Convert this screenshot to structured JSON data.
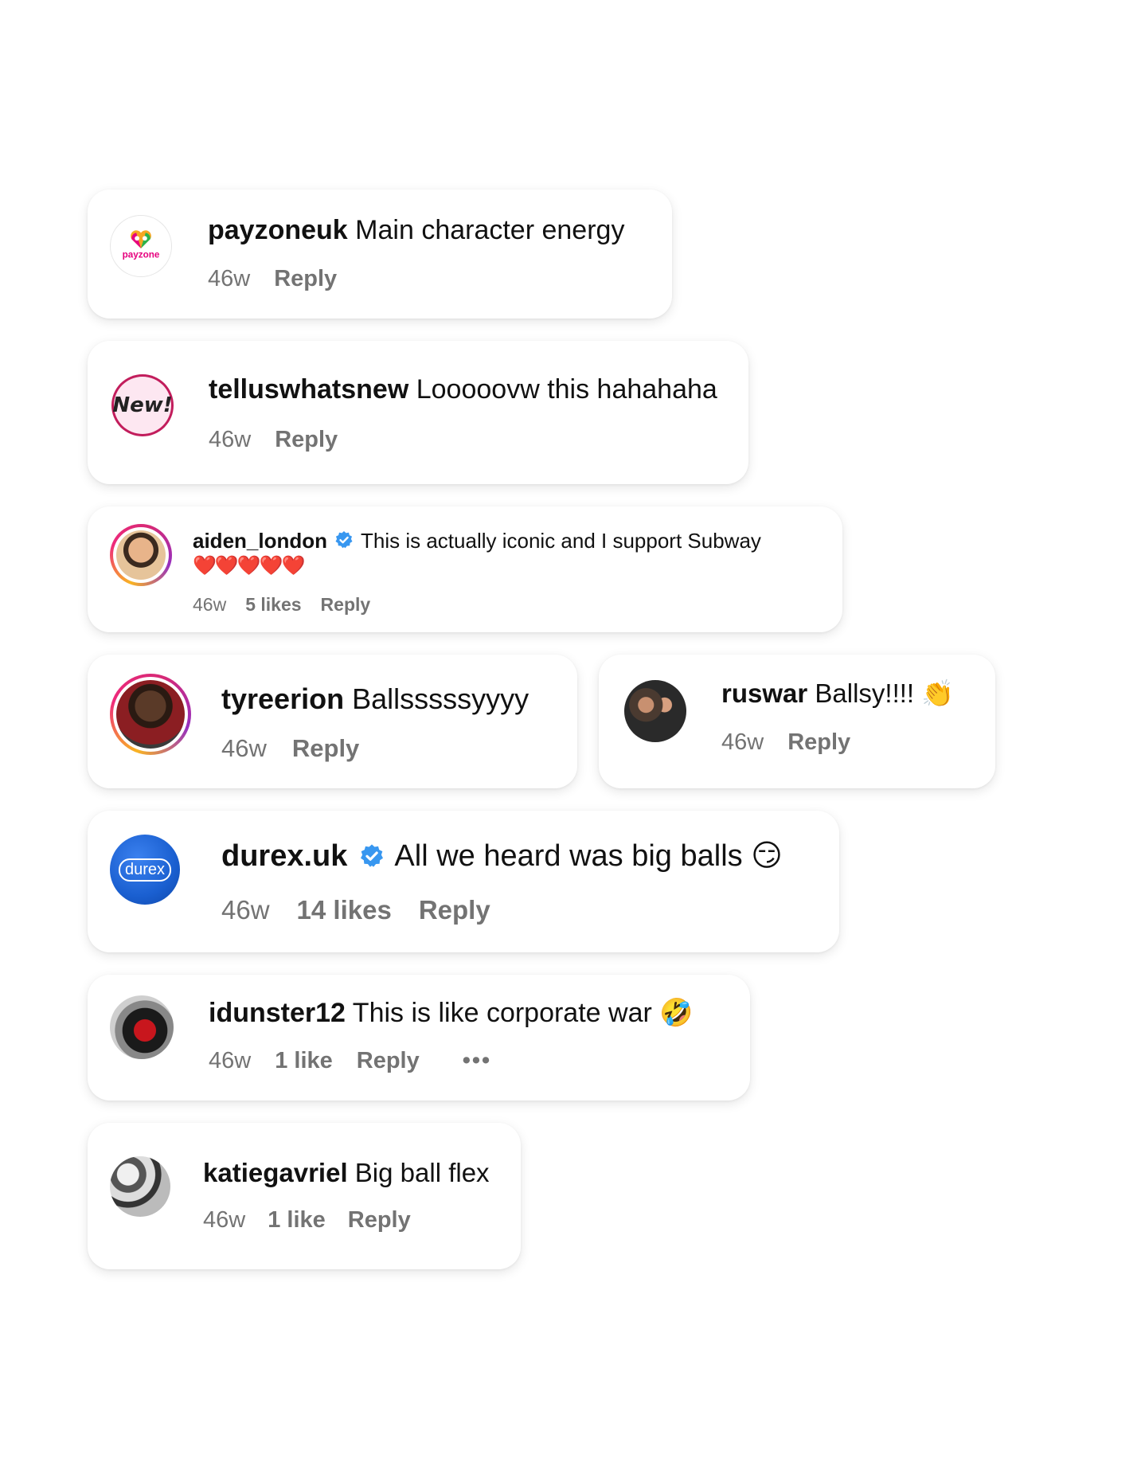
{
  "comments": [
    {
      "username": "payzoneuk",
      "text": "Main character energy",
      "time": "46w",
      "reply": "Reply",
      "avatar_label": "payzone"
    },
    {
      "username": "telluswhatsnew",
      "text": "Looooovw this hahahaha",
      "time": "46w",
      "reply": "Reply",
      "avatar_label": "New!"
    },
    {
      "username": "aiden_london",
      "verified": true,
      "text": "This is actually iconic and I support Subway",
      "text2": "❤️❤️❤️❤️❤️",
      "time": "46w",
      "likes": "5 likes",
      "reply": "Reply"
    },
    {
      "username": "tyreerion",
      "text": "Ballsssssyyyy",
      "time": "46w",
      "reply": "Reply"
    },
    {
      "username": "ruswar",
      "text": "Ballsy!!!! 👏",
      "time": "46w",
      "reply": "Reply"
    },
    {
      "username": "durex.uk",
      "verified": true,
      "text": "All we heard was big balls 😏",
      "time": "46w",
      "likes": "14 likes",
      "reply": "Reply",
      "avatar_label": "durex"
    },
    {
      "username": "idunster12",
      "text": "This is like corporate war 🤣",
      "time": "46w",
      "likes": "1 like",
      "reply": "Reply",
      "more": "•••"
    },
    {
      "username": "katiegavriel",
      "text": "Big ball flex",
      "time": "46w",
      "likes": "1 like",
      "reply": "Reply"
    }
  ],
  "colors": {
    "verified_blue": "#3897f0",
    "meta_gray": "#737373",
    "durex_blue": "#1a5fd0",
    "payzone_pink": "#e6007e"
  }
}
